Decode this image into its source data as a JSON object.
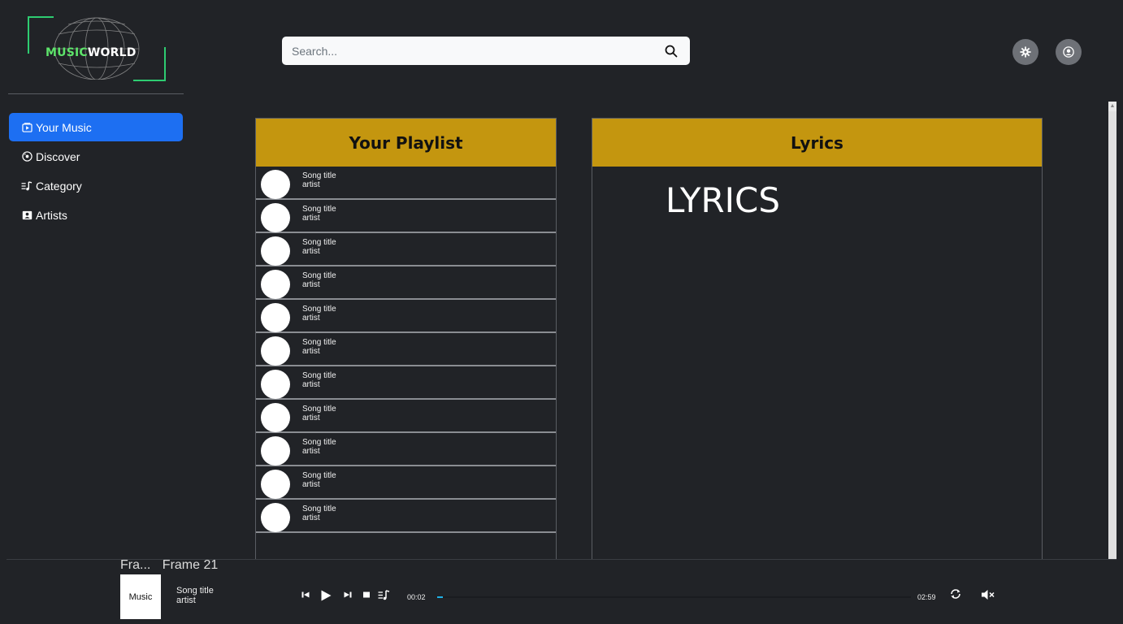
{
  "brand": {
    "name_part1": "MUSIC",
    "name_part2": "WORLD"
  },
  "search": {
    "placeholder": "Search..."
  },
  "sidebar": {
    "items": [
      {
        "label": "Your Music",
        "icon": "play-square-icon",
        "active": true
      },
      {
        "label": "Discover",
        "icon": "disc-icon",
        "active": false
      },
      {
        "label": "Category",
        "icon": "music-list-icon",
        "active": false
      },
      {
        "label": "Artists",
        "icon": "person-card-icon",
        "active": false
      }
    ]
  },
  "playlist": {
    "header": "Your Playlist",
    "songs": [
      {
        "title": "Song title",
        "artist": "artist"
      },
      {
        "title": "Song title",
        "artist": "artist"
      },
      {
        "title": "Song title",
        "artist": "artist"
      },
      {
        "title": "Song title",
        "artist": "artist"
      },
      {
        "title": "Song title",
        "artist": "artist"
      },
      {
        "title": "Song title",
        "artist": "artist"
      },
      {
        "title": "Song title",
        "artist": "artist"
      },
      {
        "title": "Song title",
        "artist": "artist"
      },
      {
        "title": "Song title",
        "artist": "artist"
      },
      {
        "title": "Song title",
        "artist": "artist"
      },
      {
        "title": "Song title",
        "artist": "artist"
      }
    ]
  },
  "lyrics": {
    "header": "Lyrics",
    "text": "LYRICS"
  },
  "player": {
    "frame_label_1": "Fra...",
    "frame_label_2": "Frame 21",
    "album_label": "Music",
    "song_title": "Song title",
    "artist": "artist",
    "current_time": "00:02",
    "total_time": "02:59",
    "progress": 0.012
  },
  "colors": {
    "accent": "#c4960f",
    "active_nav": "#1d6ff2",
    "background": "#212327",
    "brand_green": "#5de36a",
    "progress": "#1eb0e6"
  }
}
